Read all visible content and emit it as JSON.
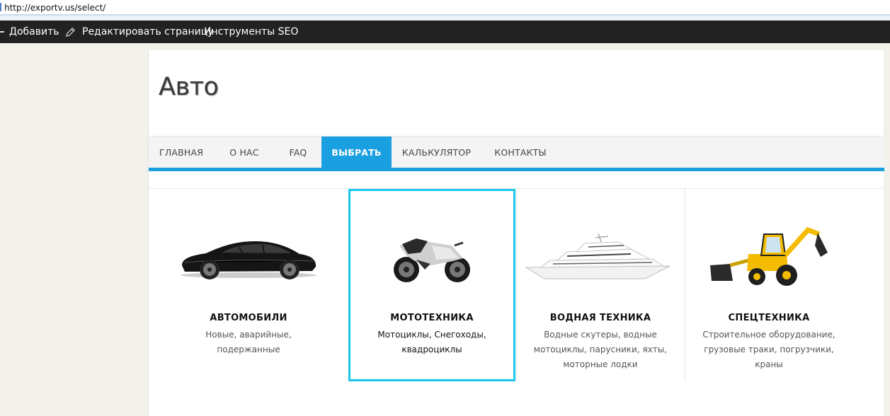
{
  "browser": {
    "url": "http://exportv.us/select/"
  },
  "admin_bar": {
    "add_label": "Добавить",
    "edit_label": "Редактировать страницу",
    "seo_label": "Инструменты SEO"
  },
  "site": {
    "title": "Авто"
  },
  "nav": {
    "items": [
      {
        "label": "ГЛАВНАЯ"
      },
      {
        "label": "О НАС"
      },
      {
        "label": "FAQ"
      },
      {
        "label": "ВЫБРАТЬ",
        "active": true
      },
      {
        "label": "КАЛЬКУЛЯТОР"
      },
      {
        "label": "КОНТАКТЫ"
      }
    ],
    "accent_color": "#1a9fe0"
  },
  "categories": [
    {
      "title": "АВТОМОБИЛИ",
      "desc": "Новые, аварийные, подержанные",
      "icon": "car-image"
    },
    {
      "title": "МОТОТЕХНИКА",
      "desc": "Мотоциклы, Снегоходы, квадроциклы",
      "icon": "motorcycle-image",
      "selected": true
    },
    {
      "title": "ВОДНАЯ ТЕХНИКА",
      "desc": "Водные скутеры, водные мотоциклы, парусники, яхты, моторные лодки",
      "icon": "yacht-image"
    },
    {
      "title": "СПЕЦТЕХНИКА",
      "desc": "Строительное оборудование, грузовые траки, погрузчики, краны",
      "icon": "backhoe-loader-image"
    }
  ],
  "highlight_color": "#1ec8ec"
}
